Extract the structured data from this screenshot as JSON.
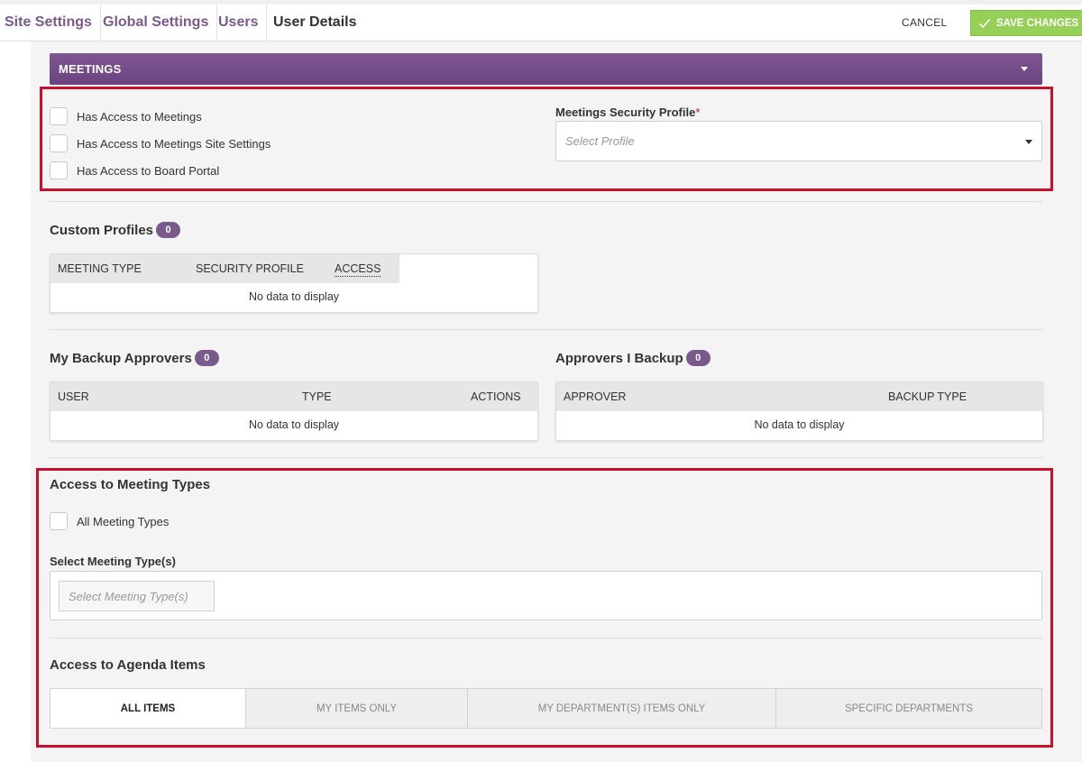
{
  "breadcrumb": [
    "Site Settings",
    "Global Settings",
    "Users",
    "User Details"
  ],
  "toolbar": {
    "cancel_label": "CANCEL",
    "save_label": "SAVE CHANGES"
  },
  "meetings": {
    "header": "MEETINGS",
    "checkboxes": [
      "Has Access to Meetings",
      "Has Access to Meetings Site Settings",
      "Has Access to Board Portal"
    ],
    "security_profile": {
      "label": "Meetings Security Profile",
      "required_mark": "*",
      "placeholder": "Select Profile"
    }
  },
  "custom_profiles": {
    "title": "Custom Profiles",
    "count": "0",
    "columns": [
      "MEETING TYPE",
      "SECURITY PROFILE",
      "ACCESS"
    ],
    "empty_text": "No data to display"
  },
  "backup_approvers": {
    "title": "My Backup Approvers",
    "count": "0",
    "columns": [
      "USER",
      "TYPE",
      "ACTIONS"
    ],
    "empty_text": "No data to display"
  },
  "approvers_i_backup": {
    "title": "Approvers I Backup",
    "count": "0",
    "columns": [
      "APPROVER",
      "BACKUP TYPE"
    ],
    "empty_text": "No data to display"
  },
  "meeting_types": {
    "title": "Access to Meeting Types",
    "all_label": "All Meeting Types",
    "select_label": "Select Meeting Type(s)",
    "select_placeholder": "Select Meeting Type(s)"
  },
  "agenda_items": {
    "title": "Access to Agenda Items",
    "tabs": [
      "ALL ITEMS",
      "MY ITEMS ONLY",
      "MY DEPARTMENT(S) ITEMS ONLY",
      "SPECIFIC DEPARTMENTS"
    ],
    "active_tab": "ALL ITEMS"
  },
  "colors": {
    "accent": "#7a5a8c",
    "save": "#95cf58",
    "highlight": "#c8102e"
  }
}
